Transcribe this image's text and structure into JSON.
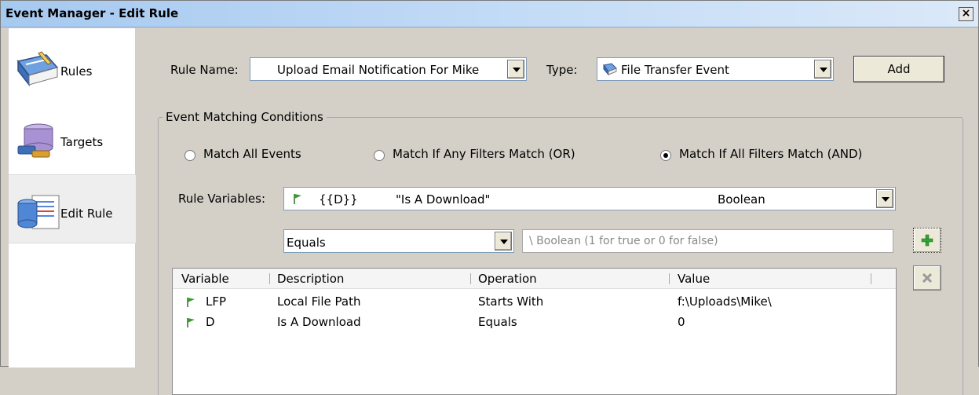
{
  "window": {
    "title": "Event Manager - Edit Rule",
    "close_label": "×"
  },
  "sidebar": {
    "items": [
      {
        "label": "Rules",
        "icon": "rules-book-icon"
      },
      {
        "label": "Targets",
        "icon": "targets-database-icon"
      },
      {
        "label": "Edit Rule",
        "icon": "edit-rule-icon",
        "active": true
      }
    ]
  },
  "header": {
    "rule_name_label": "Rule Name:",
    "rule_name_value": "Upload Email Notification For Mike",
    "type_label": "Type:",
    "type_value": "File Transfer Event",
    "type_icon": "file-transfer-icon",
    "add_label": "Add"
  },
  "conditions": {
    "group_title": "Event Matching Conditions",
    "radios": [
      {
        "label": "Match All Events",
        "checked": false
      },
      {
        "label": "Match If Any Filters Match (OR)",
        "checked": false
      },
      {
        "label": "Match If All Filters Match (AND)",
        "checked": true
      }
    ],
    "rule_variables_label": "Rule Variables:",
    "rule_variable": {
      "token": "{{D}}",
      "name": "\"Is A Download\"",
      "type": "Boolean"
    },
    "operation_value": "Equals",
    "value_placeholder": "A Boolean (1 for true or 0 for false)",
    "value_visible": "\\ Boolean (1 for true or 0 for false)"
  },
  "filters": {
    "columns": [
      "Variable",
      "Description",
      "Operation",
      "Value"
    ],
    "rows": [
      {
        "variable": "LFP",
        "description": "Local File Path",
        "operation": "Starts With",
        "value": "f:\\Uploads\\Mike\\"
      },
      {
        "variable": "D",
        "description": "Is A Download",
        "operation": "Equals",
        "value": "0"
      }
    ]
  },
  "colors": {
    "title_gradient_start": "#a6c9f0",
    "window_bg": "#d4d0c8",
    "flag_green": "#3c9a2e",
    "add_plus_green": "#35a335"
  }
}
